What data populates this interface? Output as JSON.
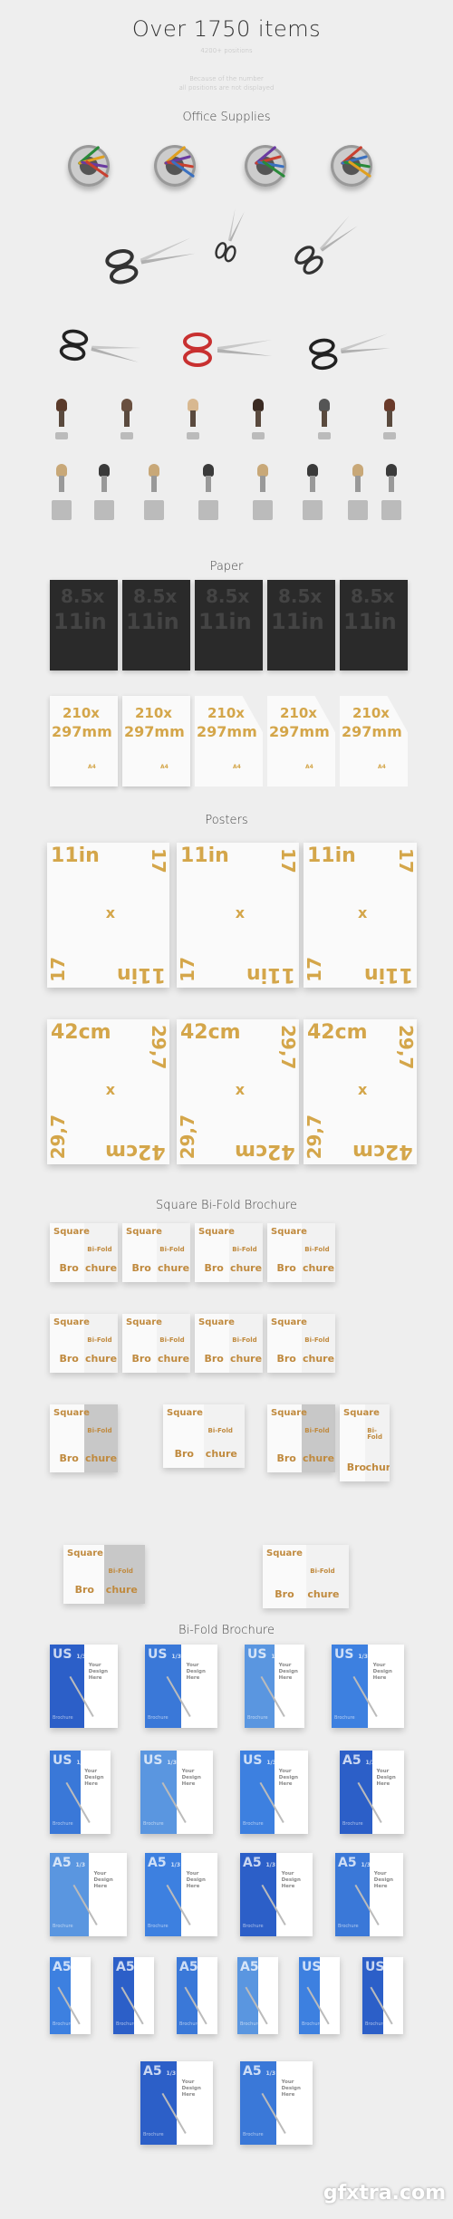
{
  "header": {
    "title": "Over 1750 items",
    "subtitle": "4200+ positions",
    "note_line1": "Because of the number",
    "note_line2": "all positions are not displayed"
  },
  "sections": {
    "office": "Office Supplies",
    "paper": "Paper",
    "posters": "Posters",
    "square_bifold": "Square Bi-Fold Brochure",
    "bifold": "Bi-Fold Brochure"
  },
  "paper": {
    "black_text": [
      "8.5x",
      "11in"
    ],
    "white_text": [
      "210x",
      "297mm"
    ],
    "white_size": "A4"
  },
  "posters": {
    "us": [
      "11in",
      "17",
      "x"
    ],
    "a": [
      "42cm",
      "29,7",
      "x"
    ]
  },
  "square_brochure": {
    "words": [
      "Square",
      "Bi-Fold",
      "Bro",
      "chure"
    ]
  },
  "bifold_brochure": {
    "design_text": [
      "Your",
      "Design",
      "Here"
    ],
    "back_label": "Brochure",
    "fraction": "1/3",
    "rows": [
      [
        "US",
        "US",
        "US",
        "US"
      ],
      [
        "US",
        "US",
        "US",
        "A5"
      ],
      [
        "A5",
        "A5",
        "A5",
        "A5"
      ],
      [
        "A5",
        "A5",
        "A5",
        "A5",
        "US",
        "US"
      ],
      [
        "A5",
        "A5"
      ]
    ]
  },
  "colors": {
    "background": "#eeeeee",
    "gold": "#d4a64a",
    "blue": "#3a78d8",
    "black_paper": "#2a2a2a"
  },
  "watermark": "gfxtra.com"
}
